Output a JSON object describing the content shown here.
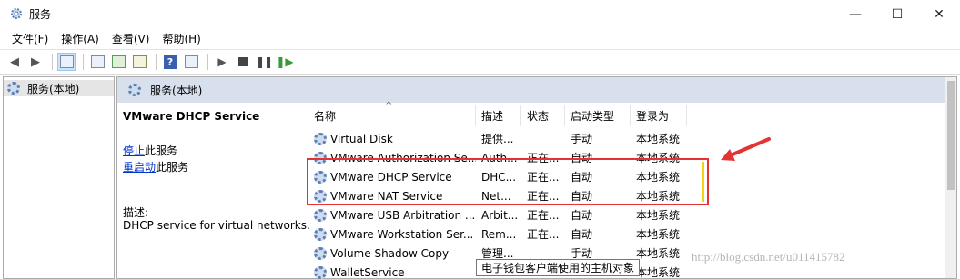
{
  "window": {
    "title": "服务",
    "minimize_icon": "—",
    "maximize_icon": "☐",
    "close_icon": "✕"
  },
  "menu": [
    "文件(F)",
    "操作(A)",
    "查看(V)",
    "帮助(H)"
  ],
  "toolbar": {
    "help_icon": "?"
  },
  "tree": {
    "selected": "服务(本地)"
  },
  "pane_header": "服务(本地)",
  "detail": {
    "title": "VMware DHCP Service",
    "stop_link": "停止",
    "stop_suffix": "此服务",
    "restart_link": "重启动",
    "restart_suffix": "此服务",
    "desc_label": "描述:",
    "desc_text": "DHCP service for virtual networks."
  },
  "columns": [
    "名称",
    "描述",
    "状态",
    "启动类型",
    "登录为"
  ],
  "services": [
    {
      "name": "Virtual Disk",
      "desc": "提供...",
      "status": "",
      "startup": "手动",
      "logon": "本地系统"
    },
    {
      "name": "VMware Authorization Se...",
      "desc": "Auth...",
      "status": "正在...",
      "startup": "自动",
      "logon": "本地系统"
    },
    {
      "name": "VMware DHCP Service",
      "desc": "DHC...",
      "status": "正在...",
      "startup": "自动",
      "logon": "本地系统"
    },
    {
      "name": "VMware NAT Service",
      "desc": "Net...",
      "status": "正在...",
      "startup": "自动",
      "logon": "本地系统"
    },
    {
      "name": "VMware USB Arbitration ...",
      "desc": "Arbit...",
      "status": "正在...",
      "startup": "自动",
      "logon": "本地系统"
    },
    {
      "name": "VMware Workstation Ser...",
      "desc": "Rem...",
      "status": "正在...",
      "startup": "自动",
      "logon": "本地系统"
    },
    {
      "name": "Volume Shadow Copy",
      "desc": "管理...",
      "status": "",
      "startup": "手动",
      "logon": "本地系统"
    },
    {
      "name": "WalletService",
      "desc": "",
      "status": "",
      "startup": "",
      "logon": "本地系统"
    }
  ],
  "tooltip": "电子钱包客户端使用的主机对象",
  "watermark": "http://blog.csdn.net/u011415782",
  "colors": {
    "highlight": "#e53333",
    "marker": "#f5d10f",
    "link": "#0033cc"
  }
}
